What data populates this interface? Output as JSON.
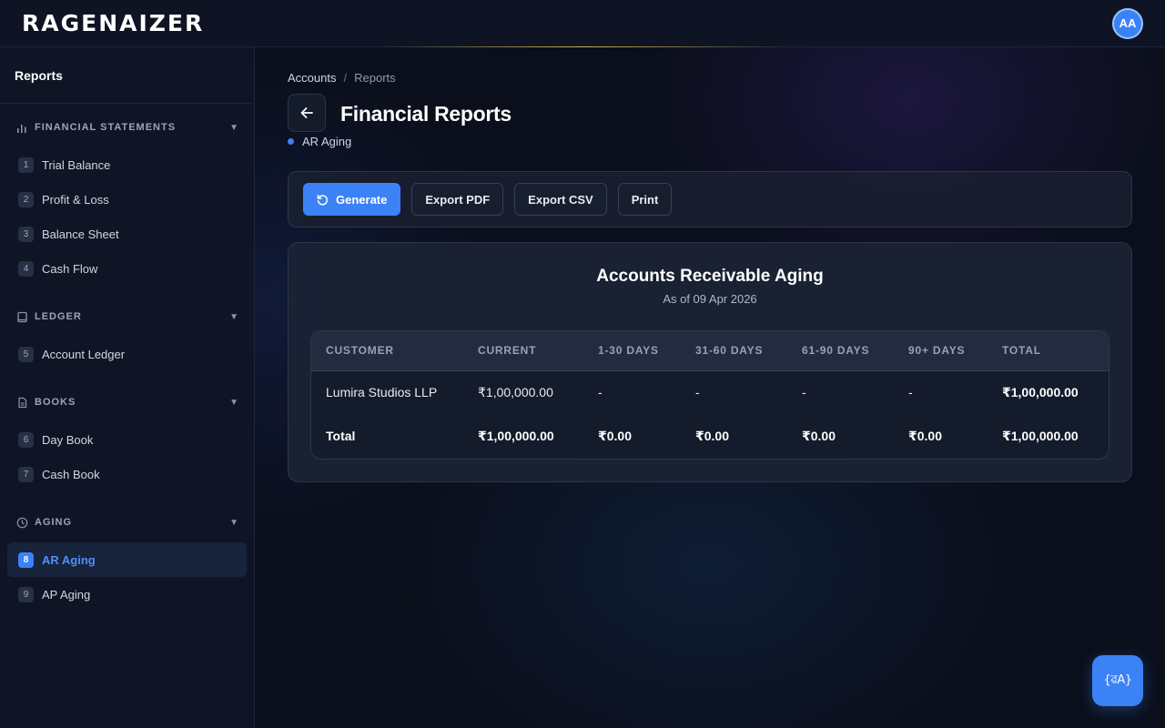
{
  "header": {
    "logo": "RAGENAIZER",
    "avatar_initials": "AA"
  },
  "sidebar": {
    "title": "Reports",
    "sections": [
      {
        "label": "FINANCIAL STATEMENTS",
        "icon": "bar-chart-icon",
        "items": [
          {
            "num": "1",
            "label": "Trial Balance"
          },
          {
            "num": "2",
            "label": "Profit & Loss"
          },
          {
            "num": "3",
            "label": "Balance Sheet"
          },
          {
            "num": "4",
            "label": "Cash Flow"
          }
        ]
      },
      {
        "label": "LEDGER",
        "icon": "book-icon",
        "items": [
          {
            "num": "5",
            "label": "Account Ledger"
          }
        ]
      },
      {
        "label": "BOOKS",
        "icon": "document-icon",
        "items": [
          {
            "num": "6",
            "label": "Day Book"
          },
          {
            "num": "7",
            "label": "Cash Book"
          }
        ]
      },
      {
        "label": "AGING",
        "icon": "clock-icon",
        "items": [
          {
            "num": "8",
            "label": "AR Aging",
            "active": true
          },
          {
            "num": "9",
            "label": "AP Aging"
          }
        ]
      }
    ]
  },
  "breadcrumb": {
    "parent": "Accounts",
    "separator": "/",
    "current": "Reports"
  },
  "page": {
    "title": "Financial Reports",
    "subtitle": "AR Aging"
  },
  "toolbar": {
    "generate_label": "Generate",
    "export_pdf_label": "Export PDF",
    "export_csv_label": "Export CSV",
    "print_label": "Print"
  },
  "report": {
    "title": "Accounts Receivable Aging",
    "date": "As of 09 Apr 2026",
    "columns": [
      "CUSTOMER",
      "CURRENT",
      "1-30 DAYS",
      "31-60 DAYS",
      "61-90 DAYS",
      "90+ DAYS",
      "TOTAL"
    ],
    "rows": [
      [
        "Lumira Studios LLP",
        "₹1,00,000.00",
        "-",
        "-",
        "-",
        "-",
        "₹1,00,000.00"
      ]
    ],
    "total_row": [
      "Total",
      "₹1,00,000.00",
      "₹0.00",
      "₹0.00",
      "₹0.00",
      "₹0.00",
      "₹1,00,000.00"
    ]
  },
  "fab": {
    "icon": "assistant-icon",
    "label": "{ৱA}"
  },
  "colors": {
    "accent": "#3b82f6",
    "background": "#0b0f1b",
    "panel": "#1b2334"
  }
}
